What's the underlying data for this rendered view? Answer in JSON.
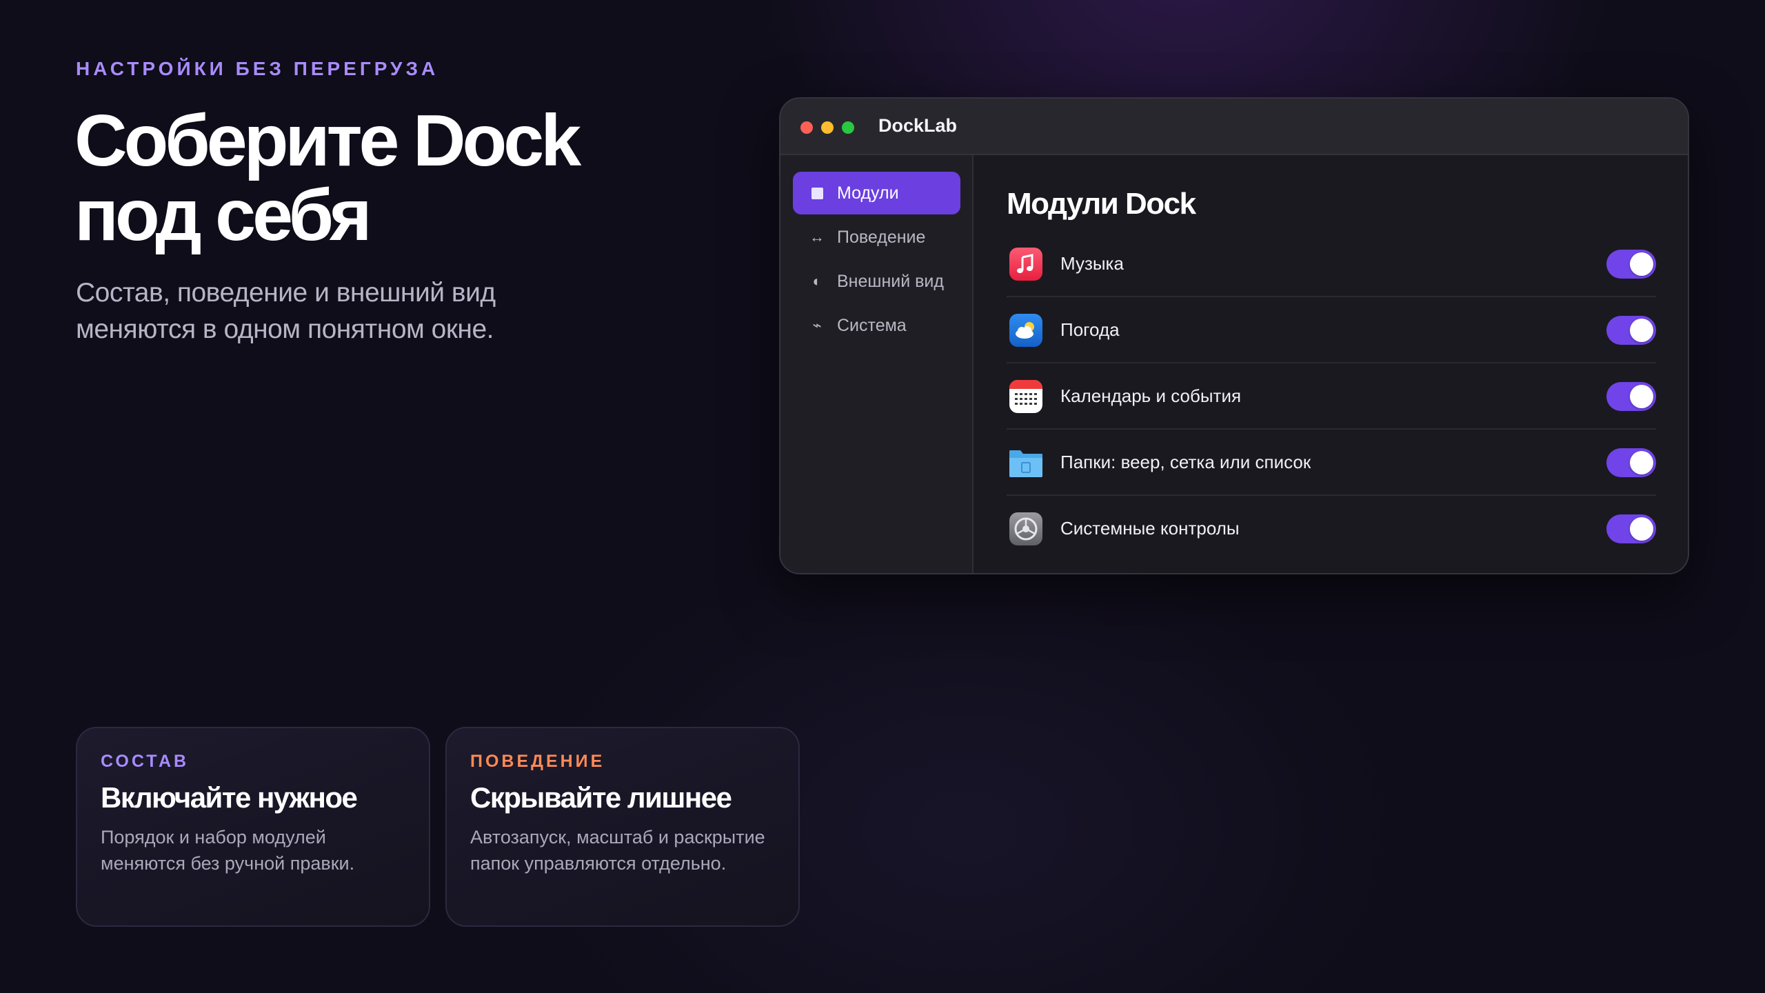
{
  "hero": {
    "eyebrow": "НАСТРОЙКИ БЕЗ ПЕРЕГРУЗА",
    "title_line1": "Соберите Dock",
    "title_line2": "под себя",
    "subtitle_line1": "Состав, поведение и внешний вид",
    "subtitle_line2": "меняются в одном понятном окне."
  },
  "window": {
    "app_name": "DockLab",
    "sidebar": {
      "items": [
        {
          "label": "Модули",
          "icon": "square-icon",
          "active": true
        },
        {
          "label": "Поведение",
          "icon": "arrows-horizontal-icon",
          "active": false
        },
        {
          "label": "Внешний вид",
          "icon": "half-circle-icon",
          "active": false
        },
        {
          "label": "Система",
          "icon": "pulse-icon",
          "active": false
        }
      ]
    },
    "content": {
      "title": "Модули Dock",
      "modules": [
        {
          "label": "Музыка",
          "icon": "music-icon",
          "enabled": true
        },
        {
          "label": "Погода",
          "icon": "weather-icon",
          "enabled": true
        },
        {
          "label": "Календарь и события",
          "icon": "calendar-icon",
          "enabled": true
        },
        {
          "label": "Папки: веер, сетка или список",
          "icon": "folder-icon",
          "enabled": true
        },
        {
          "label": "Системные контролы",
          "icon": "settings-icon",
          "enabled": true
        }
      ]
    }
  },
  "cards": [
    {
      "tag": "СОСТАВ",
      "title": "Включайте нужное",
      "text_line1": "Порядок и набор модулей",
      "text_line2": "меняются без ручной правки."
    },
    {
      "tag": "ПОВЕДЕНИЕ",
      "title": "Скрывайте лишнее",
      "text_line1": "Автозапуск, масштаб и раскрытие",
      "text_line2": "папок управляются отдельно."
    }
  ],
  "colors": {
    "background": "#0f0d19",
    "accent_purple": "#a98bff",
    "accent_orange": "#ff8a56",
    "toggle_on": "#7044e8",
    "sidebar_active": "#6b3fe0"
  }
}
